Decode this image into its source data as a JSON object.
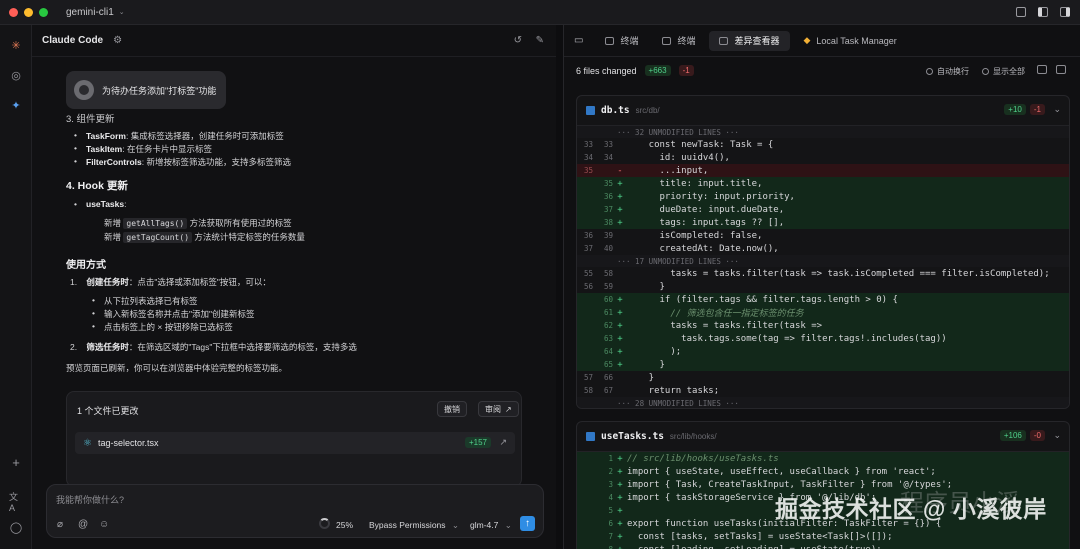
{
  "window": {
    "app_title": "gemini-cli1",
    "traffic_colors": [
      "#ff5f57",
      "#febc2e",
      "#28c840"
    ]
  },
  "chat": {
    "title": "Claude Code",
    "user_message": "为待办任务添加\"打标签\"功能",
    "section3_title": "3. 组件更新",
    "component_items": [
      {
        "name": "TaskForm",
        "desc": ": 集成标签选择器，创建任务时可添加标签"
      },
      {
        "name": "TaskItem",
        "desc": ": 在任务卡片中显示标签"
      },
      {
        "name": "FilterControls",
        "desc": ": 新增按标签筛选功能，支持多标签筛选"
      }
    ],
    "section4_title": "4. Hook 更新",
    "hook_name": "useTasks",
    "hook_colon": ":",
    "hook_items": [
      {
        "prefix": "新增",
        "code": "getAllTags()",
        "desc": "方法获取所有使用过的标签"
      },
      {
        "prefix": "新增",
        "code": "getTagCount()",
        "desc": "方法统计特定标签的任务数量"
      }
    ],
    "usage_title": "使用方式",
    "usage_step1_num": "1.",
    "usage_step1_bold": "创建任务时",
    "usage_step1_text": "：点击\"选择或添加标签\"按钮，可以：",
    "usage_sub": [
      "从下拉列表选择已有标签",
      "输入新标签名称并点击\"添加\"创建新标签",
      "点击标签上的 × 按钮移除已选标签"
    ],
    "usage_step2_num": "2.",
    "usage_step2_bold": "筛选任务时",
    "usage_step2_text": "：在筛选区域的\"Tags\"下拉框中选择要筛选的标签，支持多选",
    "footer_note": "预览页面已刷新，你可以在浏览器中体验完整的标签功能。",
    "changes_card": {
      "title": "1 个文件已更改",
      "undo_label": "撤销",
      "review_label": "审阅",
      "file_name": "tag-selector.tsx",
      "file_added": "+157"
    },
    "input": {
      "placeholder": "我能帮你做什么?",
      "progress_text": "25%",
      "progress_value": 25,
      "mode_label": "Bypass Permissions",
      "model_label": "glm-4.7"
    }
  },
  "diff_panel": {
    "tabs": [
      {
        "label": "终端",
        "active": false
      },
      {
        "label": "终端",
        "active": false
      },
      {
        "label": "差异查看器",
        "active": true
      },
      {
        "label": "Local Task Manager",
        "active": false
      }
    ],
    "summary": {
      "files_changed": "6 files changed",
      "added": "+663",
      "removed": "-1"
    },
    "options": {
      "wrap": "自动换行",
      "show_all": "显示全部"
    },
    "files": [
      {
        "name": "db.ts",
        "path": "src/db/",
        "added": "+10",
        "removed": "-1",
        "lines": [
          {
            "type": "fold",
            "text": "··· 32 UNMODIFIED LINES ···"
          },
          {
            "type": "ctx",
            "old": "33",
            "new": "33",
            "text": "    const newTask: Task = {"
          },
          {
            "type": "ctx",
            "old": "34",
            "new": "34",
            "text": "      id: uuidv4(),"
          },
          {
            "type": "del",
            "old": "35",
            "new": "",
            "text": "      ...input,"
          },
          {
            "type": "add",
            "old": "",
            "new": "35",
            "text": "      title: input.title,"
          },
          {
            "type": "add",
            "old": "",
            "new": "36",
            "text": "      priority: input.priority,"
          },
          {
            "type": "add",
            "old": "",
            "new": "37",
            "text": "      dueDate: input.dueDate,"
          },
          {
            "type": "add",
            "old": "",
            "new": "38",
            "text": "      tags: input.tags ?? [],"
          },
          {
            "type": "ctx",
            "old": "36",
            "new": "39",
            "text": "      isCompleted: false,"
          },
          {
            "type": "ctx",
            "old": "37",
            "new": "40",
            "text": "      createdAt: Date.now(),"
          },
          {
            "type": "fold",
            "text": "··· 17 UNMODIFIED LINES ···"
          },
          {
            "type": "ctx",
            "old": "55",
            "new": "58",
            "text": "        tasks = tasks.filter(task => task.isCompleted === filter.isCompleted);"
          },
          {
            "type": "ctx",
            "old": "56",
            "new": "59",
            "text": "      }"
          },
          {
            "type": "add",
            "old": "",
            "new": "60",
            "text": "      if (filter.tags && filter.tags.length > 0) {"
          },
          {
            "type": "add",
            "old": "",
            "new": "61",
            "text": "        // 筛选包含任一指定标签的任务"
          },
          {
            "type": "add",
            "old": "",
            "new": "62",
            "text": "        tasks = tasks.filter(task =>"
          },
          {
            "type": "add",
            "old": "",
            "new": "63",
            "text": "          task.tags.some(tag => filter.tags!.includes(tag))"
          },
          {
            "type": "add",
            "old": "",
            "new": "64",
            "text": "        );"
          },
          {
            "type": "add",
            "old": "",
            "new": "65",
            "text": "      }"
          },
          {
            "type": "ctx",
            "old": "57",
            "new": "66",
            "text": "    }"
          },
          {
            "type": "ctx",
            "old": "58",
            "new": "67",
            "text": "    return tasks;"
          },
          {
            "type": "fold",
            "text": "··· 28 UNMODIFIED LINES ···"
          }
        ]
      },
      {
        "name": "useTasks.ts",
        "path": "src/lib/hooks/",
        "added": "+106",
        "removed": "-0",
        "lines": [
          {
            "type": "add",
            "old": "",
            "new": "1",
            "text": "// src/lib/hooks/useTasks.ts"
          },
          {
            "type": "add",
            "old": "",
            "new": "2",
            "text": "import { useState, useEffect, useCallback } from 'react';"
          },
          {
            "type": "add",
            "old": "",
            "new": "3",
            "text": "import { Task, CreateTaskInput, TaskFilter } from '@/types';"
          },
          {
            "type": "add",
            "old": "",
            "new": "4",
            "text": "import { taskStorageService } from '@/lib/db';"
          },
          {
            "type": "add",
            "old": "",
            "new": "5",
            "text": ""
          },
          {
            "type": "add",
            "old": "",
            "new": "6",
            "text": "export function useTasks(initialFilter: TaskFilter = {}) {"
          },
          {
            "type": "add",
            "old": "",
            "new": "7",
            "text": "  const [tasks, setTasks] = useState<Task[]>([]);"
          },
          {
            "type": "add",
            "old": "",
            "new": "8",
            "text": "  const [loading, setLoading] = useState(true);"
          }
        ]
      }
    ]
  },
  "watermark": {
    "text": "掘金技术社区 @ 小溪彼岸",
    "faint_text": "程序员小溪"
  }
}
